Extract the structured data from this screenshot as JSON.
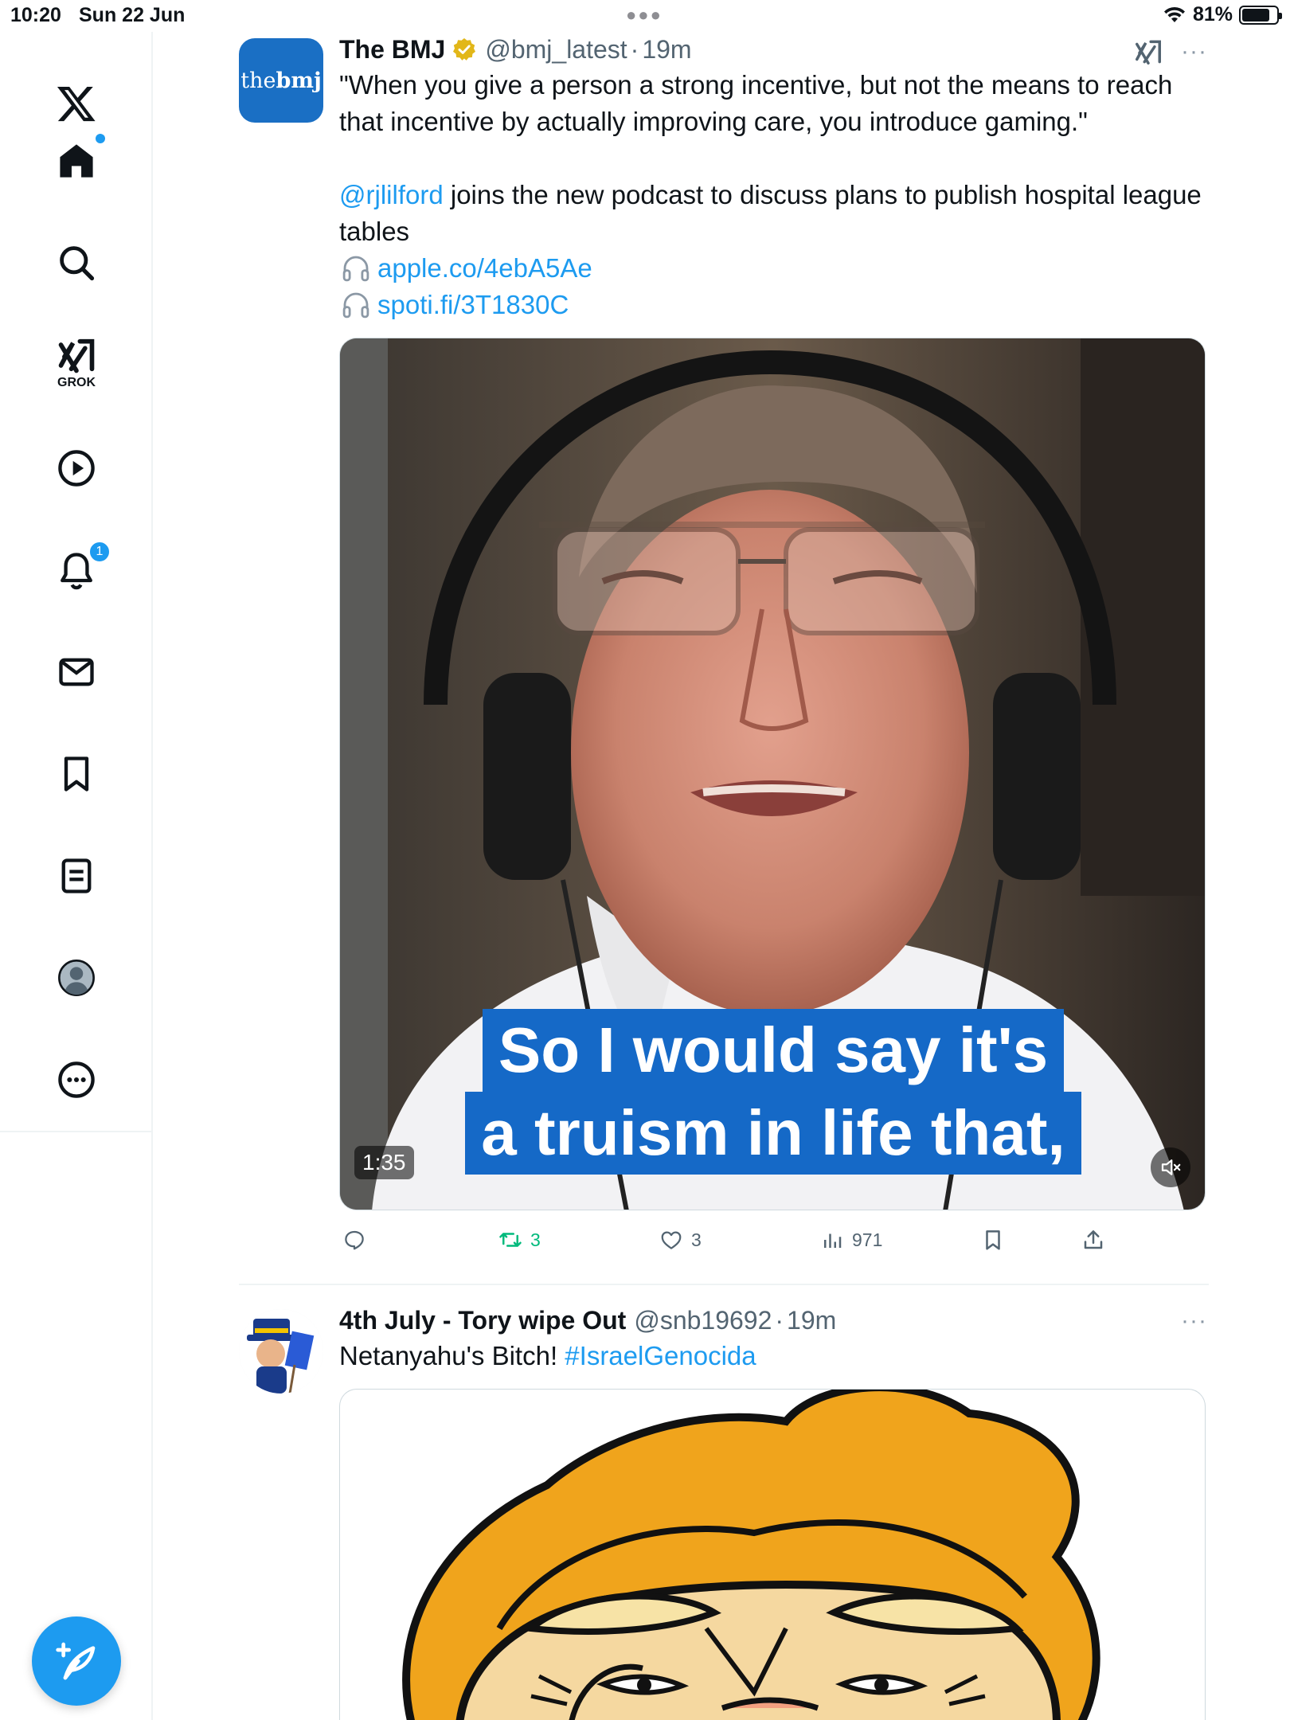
{
  "status_bar": {
    "time": "10:20",
    "date": "Sun 22 Jun",
    "battery_percent": "81%",
    "battery_level": 0.81
  },
  "sidebar": {
    "items": [
      {
        "icon": "x-logo-icon"
      },
      {
        "icon": "home-icon",
        "badge_dot": true
      },
      {
        "icon": "search-icon"
      },
      {
        "icon": "grok-icon",
        "label": "GROK"
      },
      {
        "icon": "video-play-icon"
      },
      {
        "icon": "notifications-bell-icon",
        "badge": "1"
      },
      {
        "icon": "messages-envelope-icon"
      },
      {
        "icon": "bookmark-icon"
      },
      {
        "icon": "lists-icon"
      },
      {
        "icon": "profile-avatar-icon"
      },
      {
        "icon": "more-options-icon"
      }
    ],
    "compose_icon": "compose-quill-icon"
  },
  "feed": {
    "tweets": [
      {
        "avatar_text_prefix": "the",
        "avatar_text_bold": "bmj",
        "author": "The BMJ",
        "handle": "@bmj_latest",
        "separator": "·",
        "time": "19m",
        "text_quote": "\"When you give a person a strong incentive, but not the means to reach that incentive by actually improving care, you introduce gaming.\"",
        "mention": "@rjlilford",
        "text_after_mention": " joins the new podcast to discuss plans to publish hospital league tables",
        "links": [
          "apple.co/4ebA5Ae",
          "spoti.fi/3T1830C"
        ],
        "video": {
          "duration": "1:35",
          "caption_line1": "So I would say it's",
          "caption_line2": "a truism in life that,"
        },
        "actions": {
          "reply": "",
          "retweets": "3",
          "likes": "3",
          "views": "971"
        }
      },
      {
        "author": "4th July - Tory wipe Out",
        "handle": "@snb19692",
        "separator": "·",
        "time": "19m",
        "text": "Netanyahu's Bitch! ",
        "hashtag": "#IsraelGenocida"
      }
    ]
  },
  "colors": {
    "accent": "#1d9bf0",
    "retweet_green": "#00ba7c",
    "caption_blue": "#1569c7",
    "bmj_blue": "#1a6fc4"
  }
}
